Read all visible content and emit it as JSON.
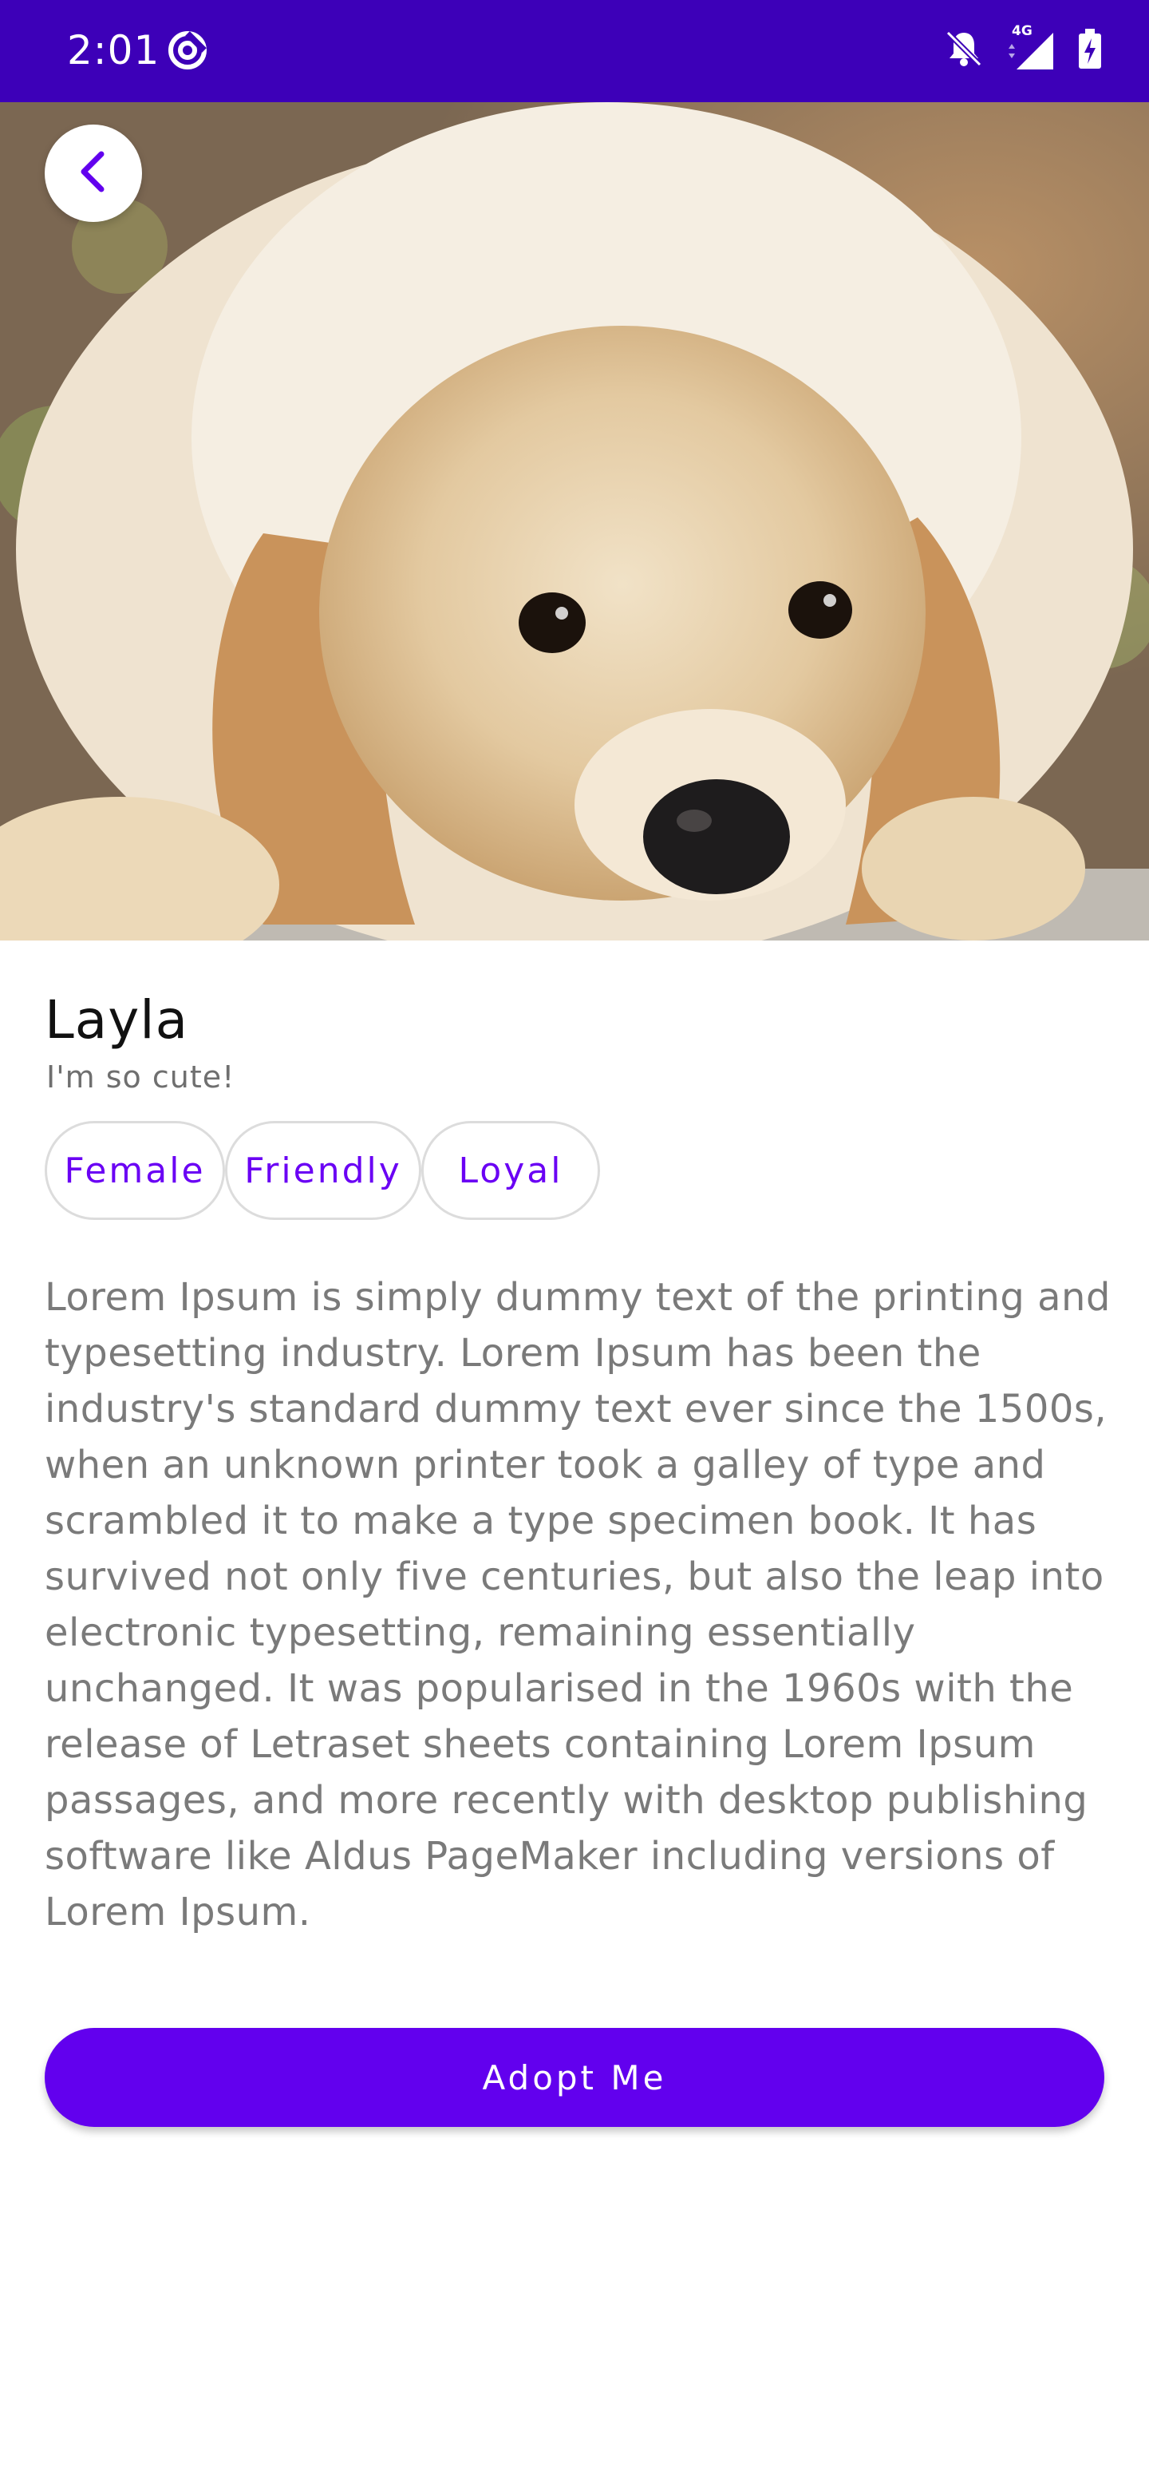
{
  "status_bar": {
    "time": "2:01",
    "network": "4G",
    "icons": [
      "data-saver-icon",
      "notifications-off-icon",
      "signal-icon",
      "battery-charging-icon"
    ]
  },
  "header": {
    "back_icon": "chevron-left-icon"
  },
  "pet": {
    "name": "Layla",
    "tagline": "I'm so cute!",
    "traits": [
      "Female",
      "Friendly",
      "Loyal"
    ],
    "description": "Lorem Ipsum is simply dummy text of the printing and typesetting industry. Lorem Ipsum has been the industry's standard dummy text ever since the 1500s, when an unknown printer took a galley of type and scrambled it to make a type specimen book. It has survived not only five centuries, but also the leap into electronic typesetting, remaining essentially unchanged. It was popularised in the 1960s with the release of Letraset sheets containing Lorem Ipsum passages, and more recently with desktop publishing software like Aldus PageMaker including versions of Lorem Ipsum."
  },
  "actions": {
    "adopt_label": "Adopt Me"
  },
  "colors": {
    "status_bar": "#3d00b8",
    "primary": "#6200ee",
    "chip_text": "#6a00f4"
  }
}
